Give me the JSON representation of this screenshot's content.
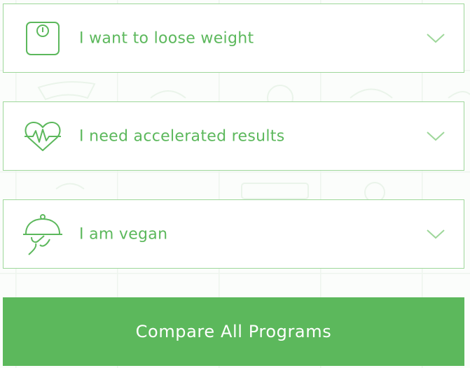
{
  "goals": [
    {
      "label": "I want to loose weight",
      "icon": "scale-icon",
      "expand_icon": "chevron-down-icon"
    },
    {
      "label": "I need accelerated results",
      "icon": "heart-pulse-icon",
      "expand_icon": "chevron-down-icon"
    },
    {
      "label": "I am vegan",
      "icon": "serving-cloche-icon",
      "expand_icon": "chevron-down-icon"
    }
  ],
  "compare_button": {
    "label": "Compare All Programs"
  },
  "colors": {
    "accent": "#5cb85c",
    "border": "#9ed79a",
    "background": "#ffffff"
  }
}
